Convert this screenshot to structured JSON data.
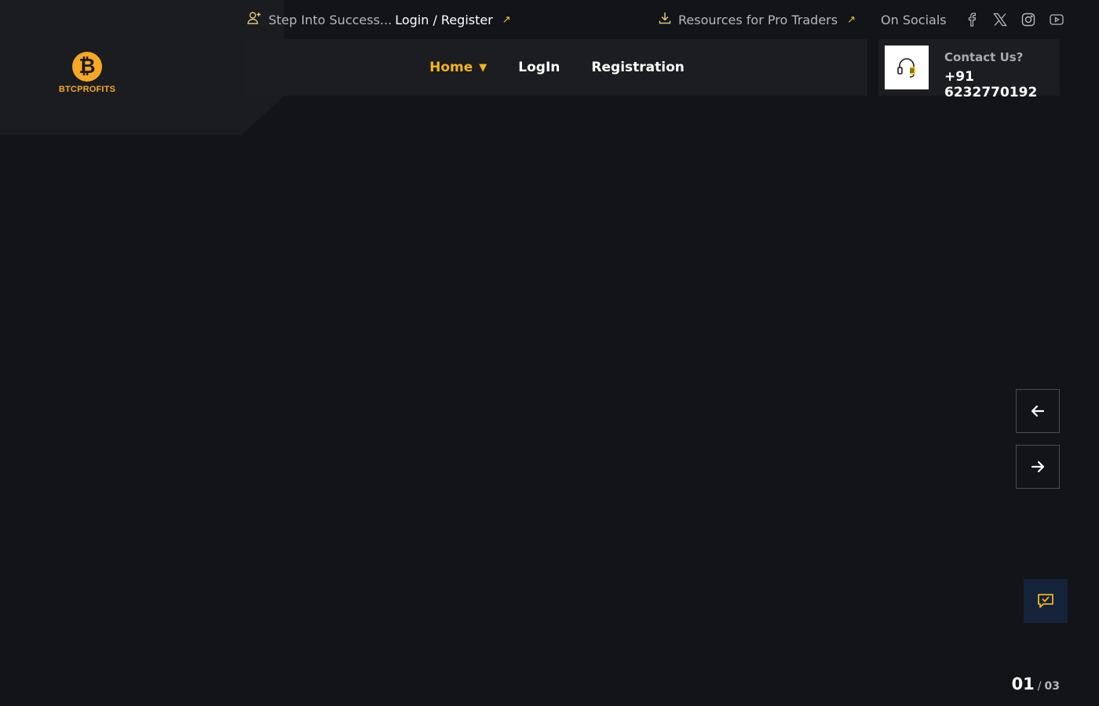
{
  "brand": {
    "logo_symbol": "₿",
    "name": "BTCPROFITS",
    "accent_color": "#f7a823"
  },
  "topbar": {
    "tagline": "Step Into Success...",
    "auth_link": "Login / Register",
    "resources_link": "Resources for Pro Traders",
    "socials_label": "On Socials",
    "icons": [
      "add-user-icon",
      "download-icon",
      "arrow-up-right-icon",
      "facebook-icon",
      "x-twitter-icon",
      "instagram-icon",
      "youtube-icon"
    ]
  },
  "nav": {
    "items": [
      {
        "label": "Home",
        "active": true
      },
      {
        "label": "LogIn",
        "active": false
      },
      {
        "label": "Registration",
        "active": false
      }
    ],
    "caret": "▼"
  },
  "contact": {
    "label": "Contact Us?",
    "phone": "+91 6232770192"
  },
  "slider": {
    "current": "01",
    "separator": "/",
    "total": "03"
  }
}
